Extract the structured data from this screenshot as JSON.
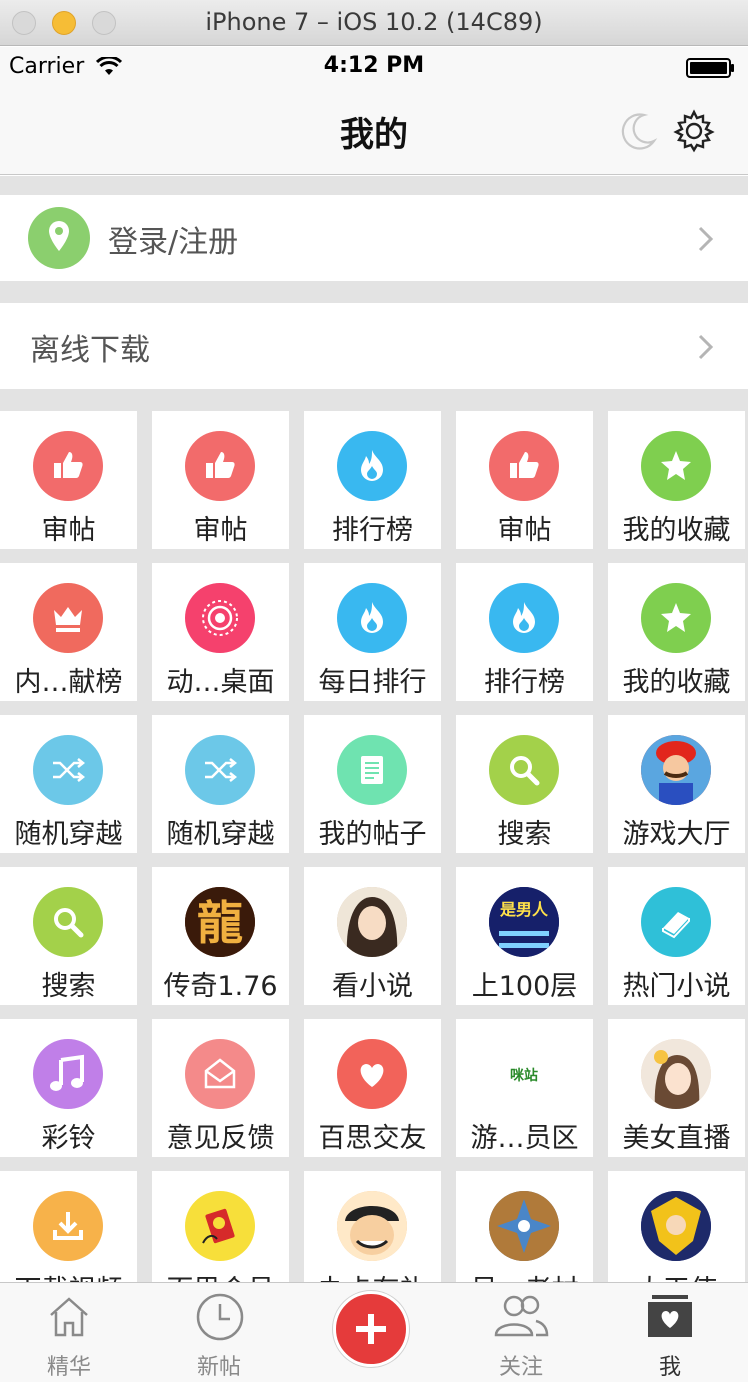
{
  "window": {
    "title": "iPhone 7 – iOS 10.2 (14C89)"
  },
  "status_bar": {
    "carrier": "Carrier",
    "time": "4:12 PM"
  },
  "nav": {
    "title": "我的"
  },
  "login_row": {
    "label": "登录/注册"
  },
  "offline_row": {
    "label": "离线下载"
  },
  "colors": {
    "red_thumb": "#f26b6b",
    "blue_fire": "#39b8f0",
    "green_star": "#7fcf4f",
    "accent_red": "#e53b3b"
  },
  "grid": [
    {
      "label": "审帖",
      "icon": "thumbs-up-icon",
      "color": "#f26b6b"
    },
    {
      "label": "审帖",
      "icon": "thumbs-up-icon",
      "color": "#f26b6b"
    },
    {
      "label": "排行榜",
      "icon": "fire-icon",
      "color": "#39b8f0"
    },
    {
      "label": "审帖",
      "icon": "thumbs-up-icon",
      "color": "#f26b6b"
    },
    {
      "label": "我的收藏",
      "icon": "star-icon",
      "color": "#7fcf4f"
    },
    {
      "label": "内…献榜",
      "icon": "crown-icon",
      "color": "#f06a5e"
    },
    {
      "label": "动…桌面",
      "icon": "target-icon",
      "color": "#f5416d"
    },
    {
      "label": "每日排行",
      "icon": "fire-icon",
      "color": "#39b8f0"
    },
    {
      "label": "排行榜",
      "icon": "fire-icon",
      "color": "#39b8f0"
    },
    {
      "label": "我的收藏",
      "icon": "star-icon",
      "color": "#7fcf4f"
    },
    {
      "label": "随机穿越",
      "icon": "shuffle-icon",
      "color": "#6cc8e8"
    },
    {
      "label": "随机穿越",
      "icon": "shuffle-icon",
      "color": "#6cc8e8"
    },
    {
      "label": "我的帖子",
      "icon": "document-icon",
      "color": "#6fe3b0"
    },
    {
      "label": "搜索",
      "icon": "search-icon",
      "color": "#a3d14a"
    },
    {
      "label": "游戏大厅",
      "icon": "mario-avatar-icon",
      "color": "#e44d3a"
    },
    {
      "label": "搜索",
      "icon": "search-icon",
      "color": "#a3d14a"
    },
    {
      "label": "传奇1.76",
      "icon": "dragon-game-icon",
      "color": "#7a3a1e"
    },
    {
      "label": "看小说",
      "icon": "girl-portrait-icon",
      "color": "#d9c2a8"
    },
    {
      "label": "上100层",
      "icon": "game-100-floors-icon",
      "color": "#1b2a7a"
    },
    {
      "label": "热门小说",
      "icon": "book-icon",
      "color": "#2fc0d8"
    },
    {
      "label": "彩铃",
      "icon": "music-note-icon",
      "color": "#c07fe8"
    },
    {
      "label": "意见反馈",
      "icon": "mail-icon",
      "color": "#f48a8a"
    },
    {
      "label": "百思交友",
      "icon": "heart-icon",
      "color": "#f2635a"
    },
    {
      "label": "游…员区",
      "icon": "game-station-logo-icon",
      "color": "#ffffff"
    },
    {
      "label": "美女直播",
      "icon": "girl-flower-portrait-icon",
      "color": "#e9d6c0"
    },
    {
      "label": "下载视频",
      "icon": "download-icon",
      "color": "#f7b24a"
    },
    {
      "label": "百思会员",
      "icon": "vip-card-icon",
      "color": "#f7df3a"
    },
    {
      "label": "办卡有礼",
      "icon": "luffy-avatar-icon",
      "color": "#f2c48a"
    },
    {
      "label": "呆…老村",
      "icon": "shuriken-icon",
      "color": "#5d6f8c"
    },
    {
      "label": "大天使",
      "icon": "warrior-avatar-icon",
      "color": "#3b4fb0"
    }
  ],
  "tabbar": {
    "items": [
      {
        "label": "精华",
        "icon": "home-icon"
      },
      {
        "label": "新帖",
        "icon": "clock-icon"
      },
      {
        "label": "",
        "icon": "plus-icon"
      },
      {
        "label": "关注",
        "icon": "people-icon"
      },
      {
        "label": "我",
        "icon": "profile-heart-icon"
      }
    ]
  }
}
